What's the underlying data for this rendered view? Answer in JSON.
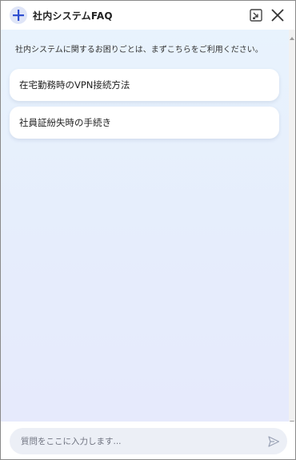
{
  "header": {
    "title": "社内システムFAQ",
    "logo_icon": "plus-icon",
    "collapse_icon": "minimize-window-icon",
    "close_icon": "close-icon"
  },
  "chat": {
    "welcome_message": "社内システムに関するお困りごとは、まずこちらをご利用ください。",
    "faq_items": [
      {
        "label": "在宅勤務時のVPN接続方法"
      },
      {
        "label": "社員証紛失時の手続き"
      }
    ]
  },
  "input": {
    "placeholder": "質問をここに入力します...",
    "value": "",
    "send_icon": "send-icon"
  },
  "colors": {
    "accent": "#2f4fd0",
    "logo_bg": "#dfe5f7",
    "chat_bg_top": "#e8f3fd",
    "chat_bg_bottom": "#e6eafc",
    "input_bg": "#eceff6"
  }
}
